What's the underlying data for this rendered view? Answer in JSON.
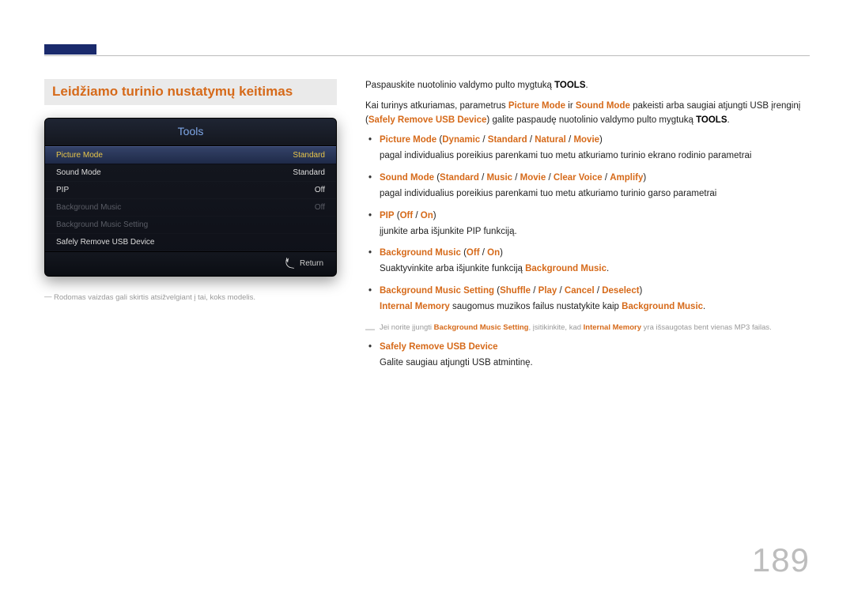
{
  "page_number": "189",
  "section_heading": "Leidžiamo turinio nustatymų keitimas",
  "device_panel": {
    "title": "Tools",
    "rows": [
      {
        "label": "Picture Mode",
        "value": "Standard",
        "state": "selected"
      },
      {
        "label": "Sound Mode",
        "value": "Standard",
        "state": "normal"
      },
      {
        "label": "PIP",
        "value": "Off",
        "state": "normal"
      },
      {
        "label": "Background Music",
        "value": "Off",
        "state": "disabled"
      },
      {
        "label": "Background Music Setting",
        "value": "",
        "state": "disabled"
      },
      {
        "label": "Safely Remove USB Device",
        "value": "",
        "state": "normal"
      }
    ],
    "footer": "Return"
  },
  "left_footnote": "Rodomas vaizdas gali skirtis atsižvelgiant į tai, koks modelis.",
  "intro_line": {
    "prefix": "Paspauskite nuotolinio valdymo pulto mygtuką ",
    "bold": "TOOLS",
    "suffix": "."
  },
  "intro_para": {
    "t1": "Kai turinys atkuriamas, parametrus ",
    "pm": "Picture Mode",
    "t2": " ir ",
    "sm": "Sound Mode",
    "t3": " pakeisti arba saugiai atjungti USB įrenginį (",
    "sr": "Safely Remove USB Device",
    "t4": ") galite paspaudę nuotolinio valdymo pulto mygtuką ",
    "tools": "TOOLS",
    "t5": "."
  },
  "items": [
    {
      "head_parts": [
        "Picture Mode",
        " (",
        "Dynamic",
        " / ",
        "Standard",
        " / ",
        "Natural",
        " / ",
        "Movie",
        ")"
      ],
      "sub": "pagal individualius poreikius parenkami tuo metu atkuriamo turinio ekrano rodinio parametrai"
    },
    {
      "head_parts": [
        "Sound Mode",
        " (",
        "Standard",
        " / ",
        "Music",
        " / ",
        "Movie",
        " / ",
        "Clear Voice",
        " / ",
        "Amplify",
        ")"
      ],
      "sub": "pagal individualius poreikius parenkami tuo metu atkuriamo turinio garso parametrai"
    },
    {
      "head_parts": [
        "PIP",
        " (",
        "Off",
        " / ",
        "On",
        ")"
      ],
      "sub": "įjunkite arba išjunkite PIP funkciją."
    },
    {
      "head_parts": [
        "Background Music",
        " (",
        "Off",
        " / ",
        "On",
        ")"
      ],
      "sub_pre": "Suaktyvinkite arba išjunkite funkciją ",
      "sub_bold": "Background Music",
      "sub_post": "."
    },
    {
      "head_parts": [
        "Background Music Setting",
        " (",
        "Shuffle",
        " / ",
        "Play",
        " / ",
        "Cancel",
        " / ",
        "Deselect",
        ")"
      ],
      "line2_a": "Internal Memory",
      "line2_b": " saugomus muzikos failus nustatykite kaip ",
      "line2_c": "Background Music",
      "line2_d": "."
    },
    {
      "head_parts": [
        "Safely Remove USB Device"
      ],
      "sub": "Galite saugiau atjungti USB atmintinę."
    }
  ],
  "mid_note": {
    "a": "Jei norite įjungti ",
    "b": "Background Music Setting",
    "c": ", įsitikinkite, kad ",
    "d": "Internal Memory",
    "e": " yra išsaugotas bent vienas MP3 failas."
  }
}
